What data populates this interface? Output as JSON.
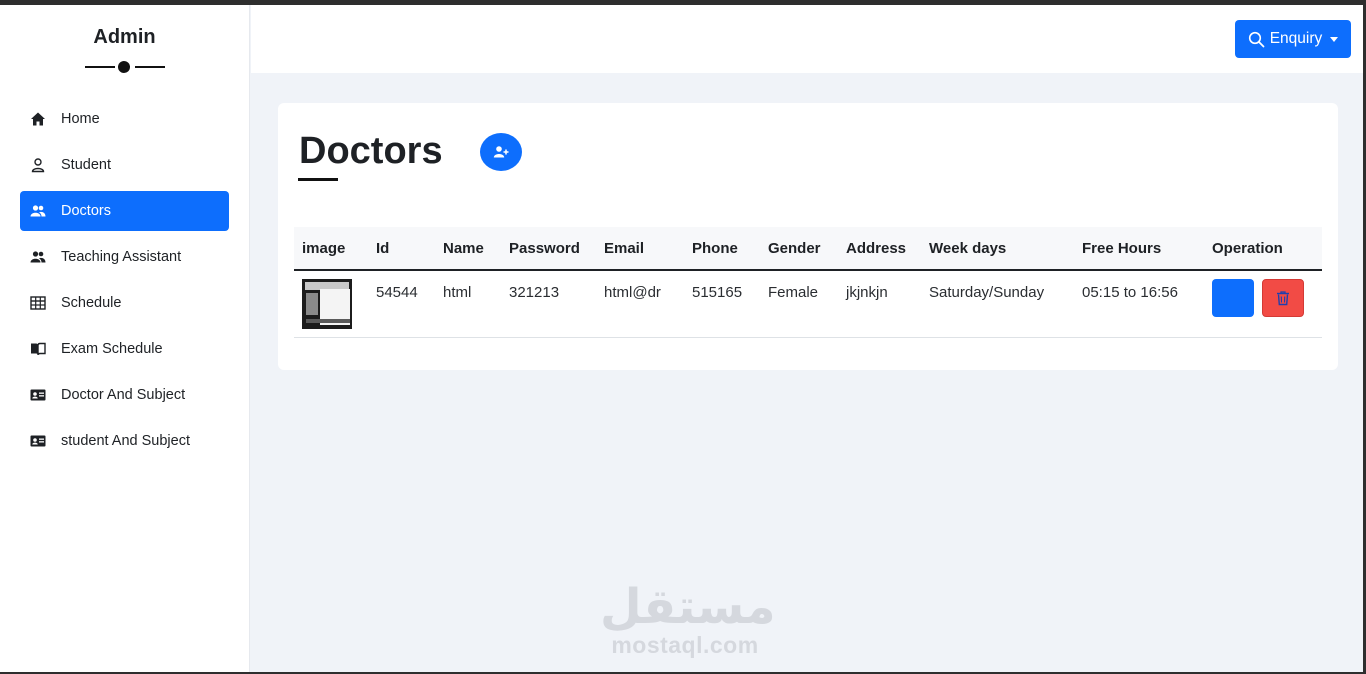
{
  "sidebar": {
    "brand": "Admin",
    "items": [
      {
        "label": "Home",
        "icon": "home-icon",
        "active": false
      },
      {
        "label": "Student",
        "icon": "user-icon",
        "active": false
      },
      {
        "label": "Doctors",
        "icon": "users-icon",
        "active": true
      },
      {
        "label": "Teaching Assistant",
        "icon": "users-icon",
        "active": false
      },
      {
        "label": "Schedule",
        "icon": "table-icon",
        "active": false
      },
      {
        "label": "Exam Schedule",
        "icon": "book-icon",
        "active": false
      },
      {
        "label": "Doctor And Subject",
        "icon": "id-card-icon",
        "active": false
      },
      {
        "label": "student And Subject",
        "icon": "id-card-icon",
        "active": false
      }
    ]
  },
  "topbar": {
    "enquiry_label": "Enquiry"
  },
  "main": {
    "title": "Doctors",
    "table": {
      "columns": [
        "image",
        "Id",
        "Name",
        "Password",
        "Email",
        "Phone",
        "Gender",
        "Address",
        "Week days",
        "Free Hours",
        "Operation"
      ],
      "rows": [
        {
          "id": "54544",
          "name": "html",
          "password": "321213",
          "email": "html@dr",
          "phone": "515165",
          "gender": "Female",
          "address": "jkjnkjn",
          "week_days": "Saturday/Sunday",
          "free_hours": "05:15 to 16:56"
        }
      ]
    }
  },
  "watermark": {
    "arabic": "مستقل",
    "latin": "mostaql.com"
  },
  "colors": {
    "primary": "#0d6efd",
    "danger": "#f24b45",
    "background": "#f0f3f8"
  }
}
